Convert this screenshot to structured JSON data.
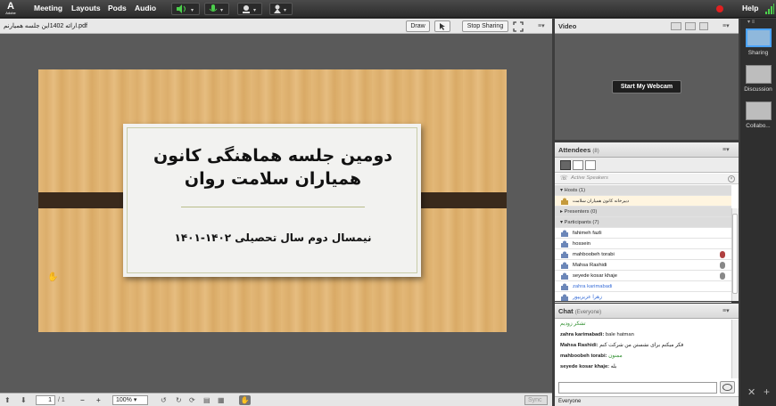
{
  "menubar": {
    "logo_text": "A",
    "logo_sub": "Adobe",
    "items": [
      "Meeting",
      "Layouts",
      "Pods",
      "Audio"
    ],
    "help": "Help"
  },
  "share": {
    "title": "ارائه 1402این جلسه همیارنم.pdf",
    "draw_label": "Draw",
    "stop_sharing_label": "Stop Sharing",
    "slide": {
      "title_line1": "دومین جلسه هماهنگی کانون",
      "title_line2": "همیاران سلامت روان",
      "subtitle": "نیمسال دوم سال تحصیلی ۱۴۰۲-۱۴۰۱"
    },
    "footer": {
      "page_current": "1",
      "page_total": "/ 1",
      "zoom": "100%",
      "sync_label": "Sync"
    }
  },
  "video": {
    "title": "Video",
    "webcam_button": "Start My Webcam"
  },
  "attendees": {
    "title": "Attendees",
    "count": "(8)",
    "active_speakers": "Active Speakers",
    "hosts_header": "Hosts (1)",
    "host_name": "دبیرخانه کانون همیاران سلامت",
    "presenters_header": "Presenters (0)",
    "participants_header": "Participants (7)",
    "participants": [
      {
        "name": "fahimeh fazli",
        "color": "#111111"
      },
      {
        "name": "hossein",
        "color": "#111111"
      },
      {
        "name": "mahboobeh torabi",
        "color": "#111111"
      },
      {
        "name": "Mahsa Rashidi",
        "color": "#111111"
      },
      {
        "name": "seyede kosar khaje",
        "color": "#111111"
      },
      {
        "name": "zahra karimabadi",
        "color": "#3a6fd8"
      },
      {
        "name": "زهرا عزیزیپور",
        "color": "#3a6fd8"
      }
    ]
  },
  "chat": {
    "title": "Chat",
    "scope": "(Everyone)",
    "messages": [
      {
        "sender": "",
        "text": "تشکر زودیم",
        "color": "#2f8f2f"
      },
      {
        "sender": "zahra karimabadi:",
        "text": " bale hatman",
        "color": "#222222"
      },
      {
        "sender": "Mahsa Rashidi:",
        "text": " فکر میکنم برای نشستن من شرکت کنم",
        "color": "#222222"
      },
      {
        "sender": "mahboobeh torabi:",
        "text": " ممنون",
        "color": "#2f8f2f"
      },
      {
        "sender": "seyede kosar khaje:",
        "text": " بله",
        "color": "#222222"
      }
    ],
    "tab_label": "Everyone"
  },
  "layouts": {
    "items": [
      "Sharing",
      "Discussion",
      "Collabo..."
    ]
  }
}
